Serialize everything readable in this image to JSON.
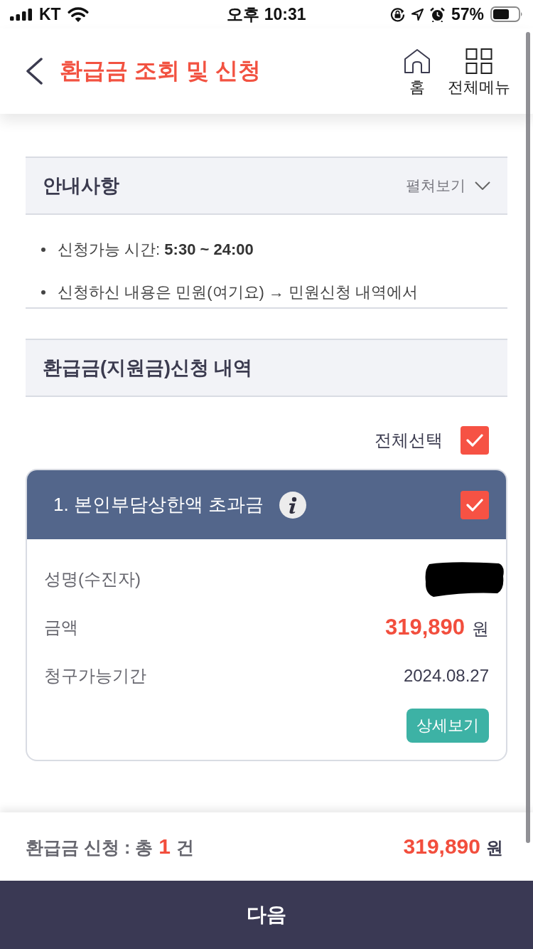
{
  "status_bar": {
    "carrier": "KT",
    "time": "오후 10:31",
    "battery": "57%"
  },
  "header": {
    "title": "환급금 조회 및 신청",
    "actions": [
      {
        "kind": "home",
        "label": "홈"
      },
      {
        "kind": "menu",
        "label": "전체메뉴"
      }
    ]
  },
  "notice": {
    "title": "안내사항",
    "toggle_label": "펼쳐보기",
    "expanded": false,
    "items": [
      "신청가능 시간: **5:30 ~ 24:00**",
      "신청하신 내용은 민원(여기요) → 민원신청 내역에서"
    ]
  },
  "claims": {
    "title": "환급금(지원금)신청 내역",
    "select_all": {
      "label": "전체선택",
      "checked": true
    },
    "items": [
      {
        "title": "1. 본인부담상한액 초과금",
        "checked": true,
        "fields": [
          {
            "kind": "redacted",
            "label": "성명(수진자)"
          },
          {
            "kind": "amount",
            "label": "금액",
            "value": "319,890",
            "unit": "원"
          },
          {
            "kind": "text",
            "label": "청구가능기간",
            "value": "2024.08.27"
          }
        ],
        "detail_button": "상세보기"
      }
    ]
  },
  "summary": {
    "label": "환급금 신청 : 총",
    "count": "1",
    "count_unit": "건",
    "amount": "319,890",
    "unit": "원"
  },
  "next_button": "다음"
}
